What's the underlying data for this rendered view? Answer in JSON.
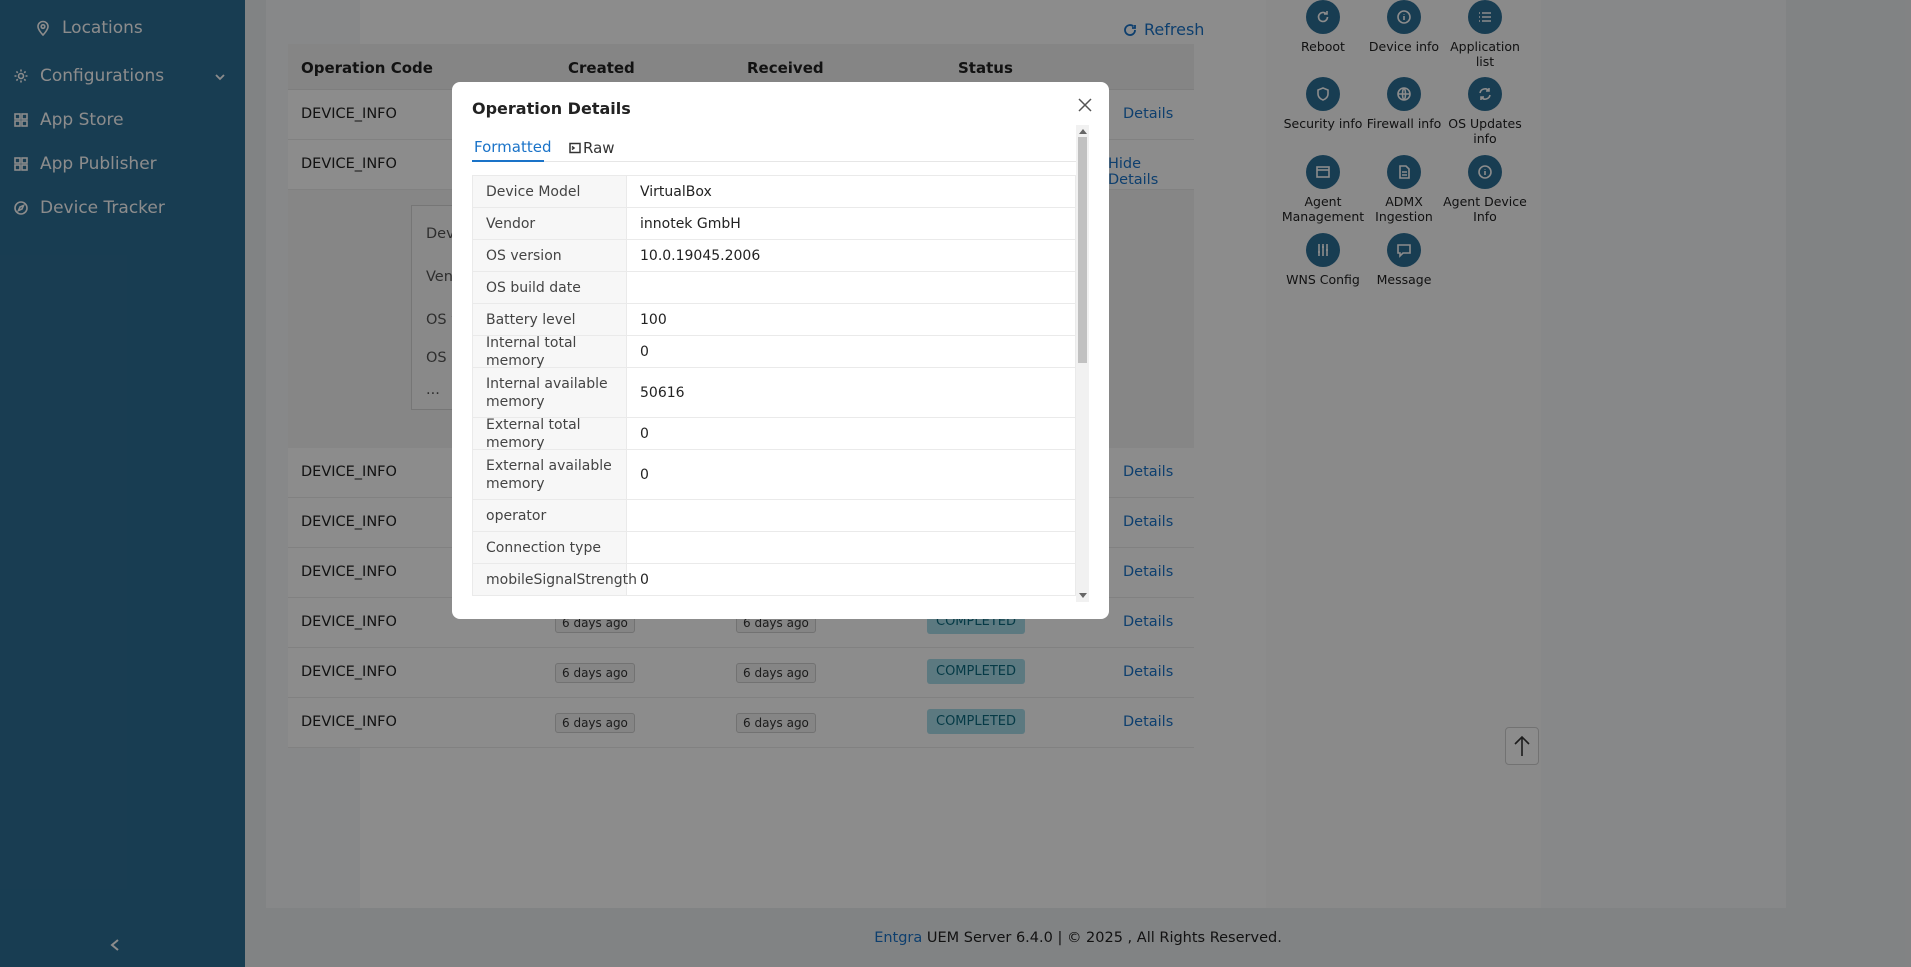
{
  "sidebar": {
    "items": [
      {
        "label": "Locations",
        "icon": "map-pin-icon"
      },
      {
        "label": "Configurations",
        "icon": "gear-icon"
      },
      {
        "label": "App Store",
        "icon": "grid-icon"
      },
      {
        "label": "App Publisher",
        "icon": "grid-icon"
      },
      {
        "label": "Device Tracker",
        "icon": "compass-icon"
      }
    ],
    "collapse_label": "<"
  },
  "toolbar": {
    "refresh_label": "Refresh"
  },
  "table": {
    "headers": [
      "Operation Code",
      "Created",
      "Received",
      "Status"
    ],
    "rows": [
      {
        "code": "DEVICE_INFO",
        "created": "",
        "received": "",
        "status": "",
        "link": "Details"
      },
      {
        "code": "DEVICE_INFO",
        "created": "",
        "received": "",
        "status": "",
        "link": "Hide Details"
      },
      {
        "code": "DEVICE_INFO",
        "created": "",
        "received": "",
        "status": "",
        "link": "Details"
      },
      {
        "code": "DEVICE_INFO",
        "created": "",
        "received": "",
        "status": "",
        "link": "Details"
      },
      {
        "code": "DEVICE_INFO",
        "created": "",
        "received": "",
        "status": "",
        "link": "Details"
      },
      {
        "code": "DEVICE_INFO",
        "created": "6 days ago",
        "received": "6 days ago",
        "status": "COMPLETED",
        "link": "Details"
      },
      {
        "code": "DEVICE_INFO",
        "created": "6 days ago",
        "received": "6 days ago",
        "status": "COMPLETED",
        "link": "Details"
      },
      {
        "code": "DEVICE_INFO",
        "created": "6 days ago",
        "received": "6 days ago",
        "status": "COMPLETED",
        "link": "Details"
      }
    ],
    "expanded_labels": [
      "Devic",
      "Venc",
      "OS v",
      "OS b",
      "..."
    ]
  },
  "operations": [
    {
      "label": "Reboot",
      "icon": "reboot-icon"
    },
    {
      "label": "Device info",
      "icon": "info-icon"
    },
    {
      "label": "Application list",
      "icon": "list-icon"
    },
    {
      "label": "Security info",
      "icon": "shield-icon"
    },
    {
      "label": "Firewall info",
      "icon": "globe-icon"
    },
    {
      "label": "OS Updates info",
      "icon": "sync-icon"
    },
    {
      "label": "Agent Management",
      "icon": "window-icon"
    },
    {
      "label": "ADMX Ingestion",
      "icon": "document-icon"
    },
    {
      "label": "Agent Device Info",
      "icon": "info-icon"
    },
    {
      "label": "WNS Config",
      "icon": "sliders-icon"
    },
    {
      "label": "Message",
      "icon": "chat-icon"
    }
  ],
  "modal": {
    "title": "Operation Details",
    "tabs": [
      {
        "label": "Formatted",
        "icon": "list-icon"
      },
      {
        "label": "Raw",
        "icon": "terminal-icon"
      }
    ],
    "details": [
      {
        "label": "Device Model",
        "value": "VirtualBox"
      },
      {
        "label": "Vendor",
        "value": "innotek GmbH"
      },
      {
        "label": "OS version",
        "value": "10.0.19045.2006"
      },
      {
        "label": "OS build date",
        "value": ""
      },
      {
        "label": "Battery level",
        "value": "100"
      },
      {
        "label": "Internal total memory",
        "value": "0"
      },
      {
        "label": "Internal available memory",
        "value": "50616"
      },
      {
        "label": "External total memory",
        "value": "0"
      },
      {
        "label": "External available memory",
        "value": "0"
      },
      {
        "label": "operator",
        "value": ""
      },
      {
        "label": "Connection type",
        "value": ""
      },
      {
        "label": "mobileSignalStrength",
        "value": "0"
      },
      {
        "label": "",
        "value": ""
      }
    ]
  },
  "footer": {
    "brand": "Entgra",
    "text": " UEM Server 6.4.0 | © 2025 , All Rights Reserved."
  },
  "colors": {
    "sidebar": "#2d6f96",
    "accent": "#1a73c8",
    "badge": "#a8ddea"
  }
}
